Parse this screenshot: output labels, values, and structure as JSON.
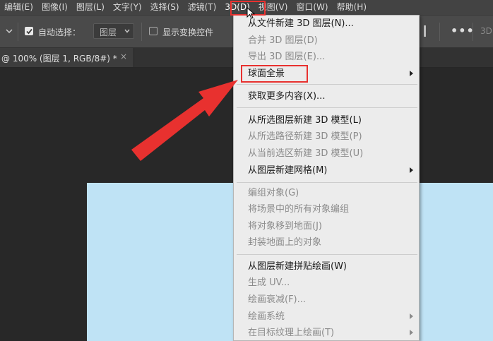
{
  "menubar": {
    "items": [
      {
        "label": "编辑(E)"
      },
      {
        "label": "图像(I)"
      },
      {
        "label": "图层(L)"
      },
      {
        "label": "文字(Y)"
      },
      {
        "label": "选择(S)"
      },
      {
        "label": "滤镜(T)"
      },
      {
        "label": "3D(D)"
      },
      {
        "label": "视图(V)"
      },
      {
        "label": "窗口(W)"
      },
      {
        "label": "帮助(H)"
      }
    ]
  },
  "options": {
    "auto_select_label": "自动选择：",
    "auto_select_checked": true,
    "target_value": "图层",
    "show_transform_label": "显示变换控件",
    "show_transform_checked": false,
    "more_label": "•••",
    "mode_label": "3D"
  },
  "document_tab": {
    "title": "@ 100% (图层 1, RGB/8#) *",
    "close_label": "×"
  },
  "menu_3d": {
    "items": [
      {
        "label": "从文件新建 3D 图层(N)...",
        "enabled": true
      },
      {
        "label": "合并 3D 图层(D)",
        "enabled": false
      },
      {
        "label": "导出 3D 图层(E)...",
        "enabled": false
      },
      {
        "label": "球面全景",
        "enabled": true,
        "submenu": true
      },
      {
        "label": "获取更多内容(X)...",
        "enabled": true
      },
      {
        "label": "从所选图层新建 3D 模型(L)",
        "enabled": true
      },
      {
        "label": "从所选路径新建 3D 模型(P)",
        "enabled": false
      },
      {
        "label": "从当前选区新建 3D 模型(U)",
        "enabled": false
      },
      {
        "label": "从图层新建网格(M)",
        "enabled": true,
        "submenu": true
      },
      {
        "label": "编组对象(G)",
        "enabled": false
      },
      {
        "label": "将场景中的所有对象编组",
        "enabled": false
      },
      {
        "label": "将对象移到地面(J)",
        "enabled": false
      },
      {
        "label": "封装地面上的对象",
        "enabled": false
      },
      {
        "label": "从图层新建拼贴绘画(W)",
        "enabled": true
      },
      {
        "label": "生成 UV...",
        "enabled": false
      },
      {
        "label": "绘画衰减(F)...",
        "enabled": false
      },
      {
        "label": "绘画系统",
        "enabled": false,
        "submenu": true
      },
      {
        "label": "在目标纹理上绘画(T)",
        "enabled": false,
        "submenu": true
      }
    ]
  },
  "colors": {
    "highlight": "#e8312f",
    "canvas": "#bfe3f5",
    "menu_bg": "#ececec"
  }
}
